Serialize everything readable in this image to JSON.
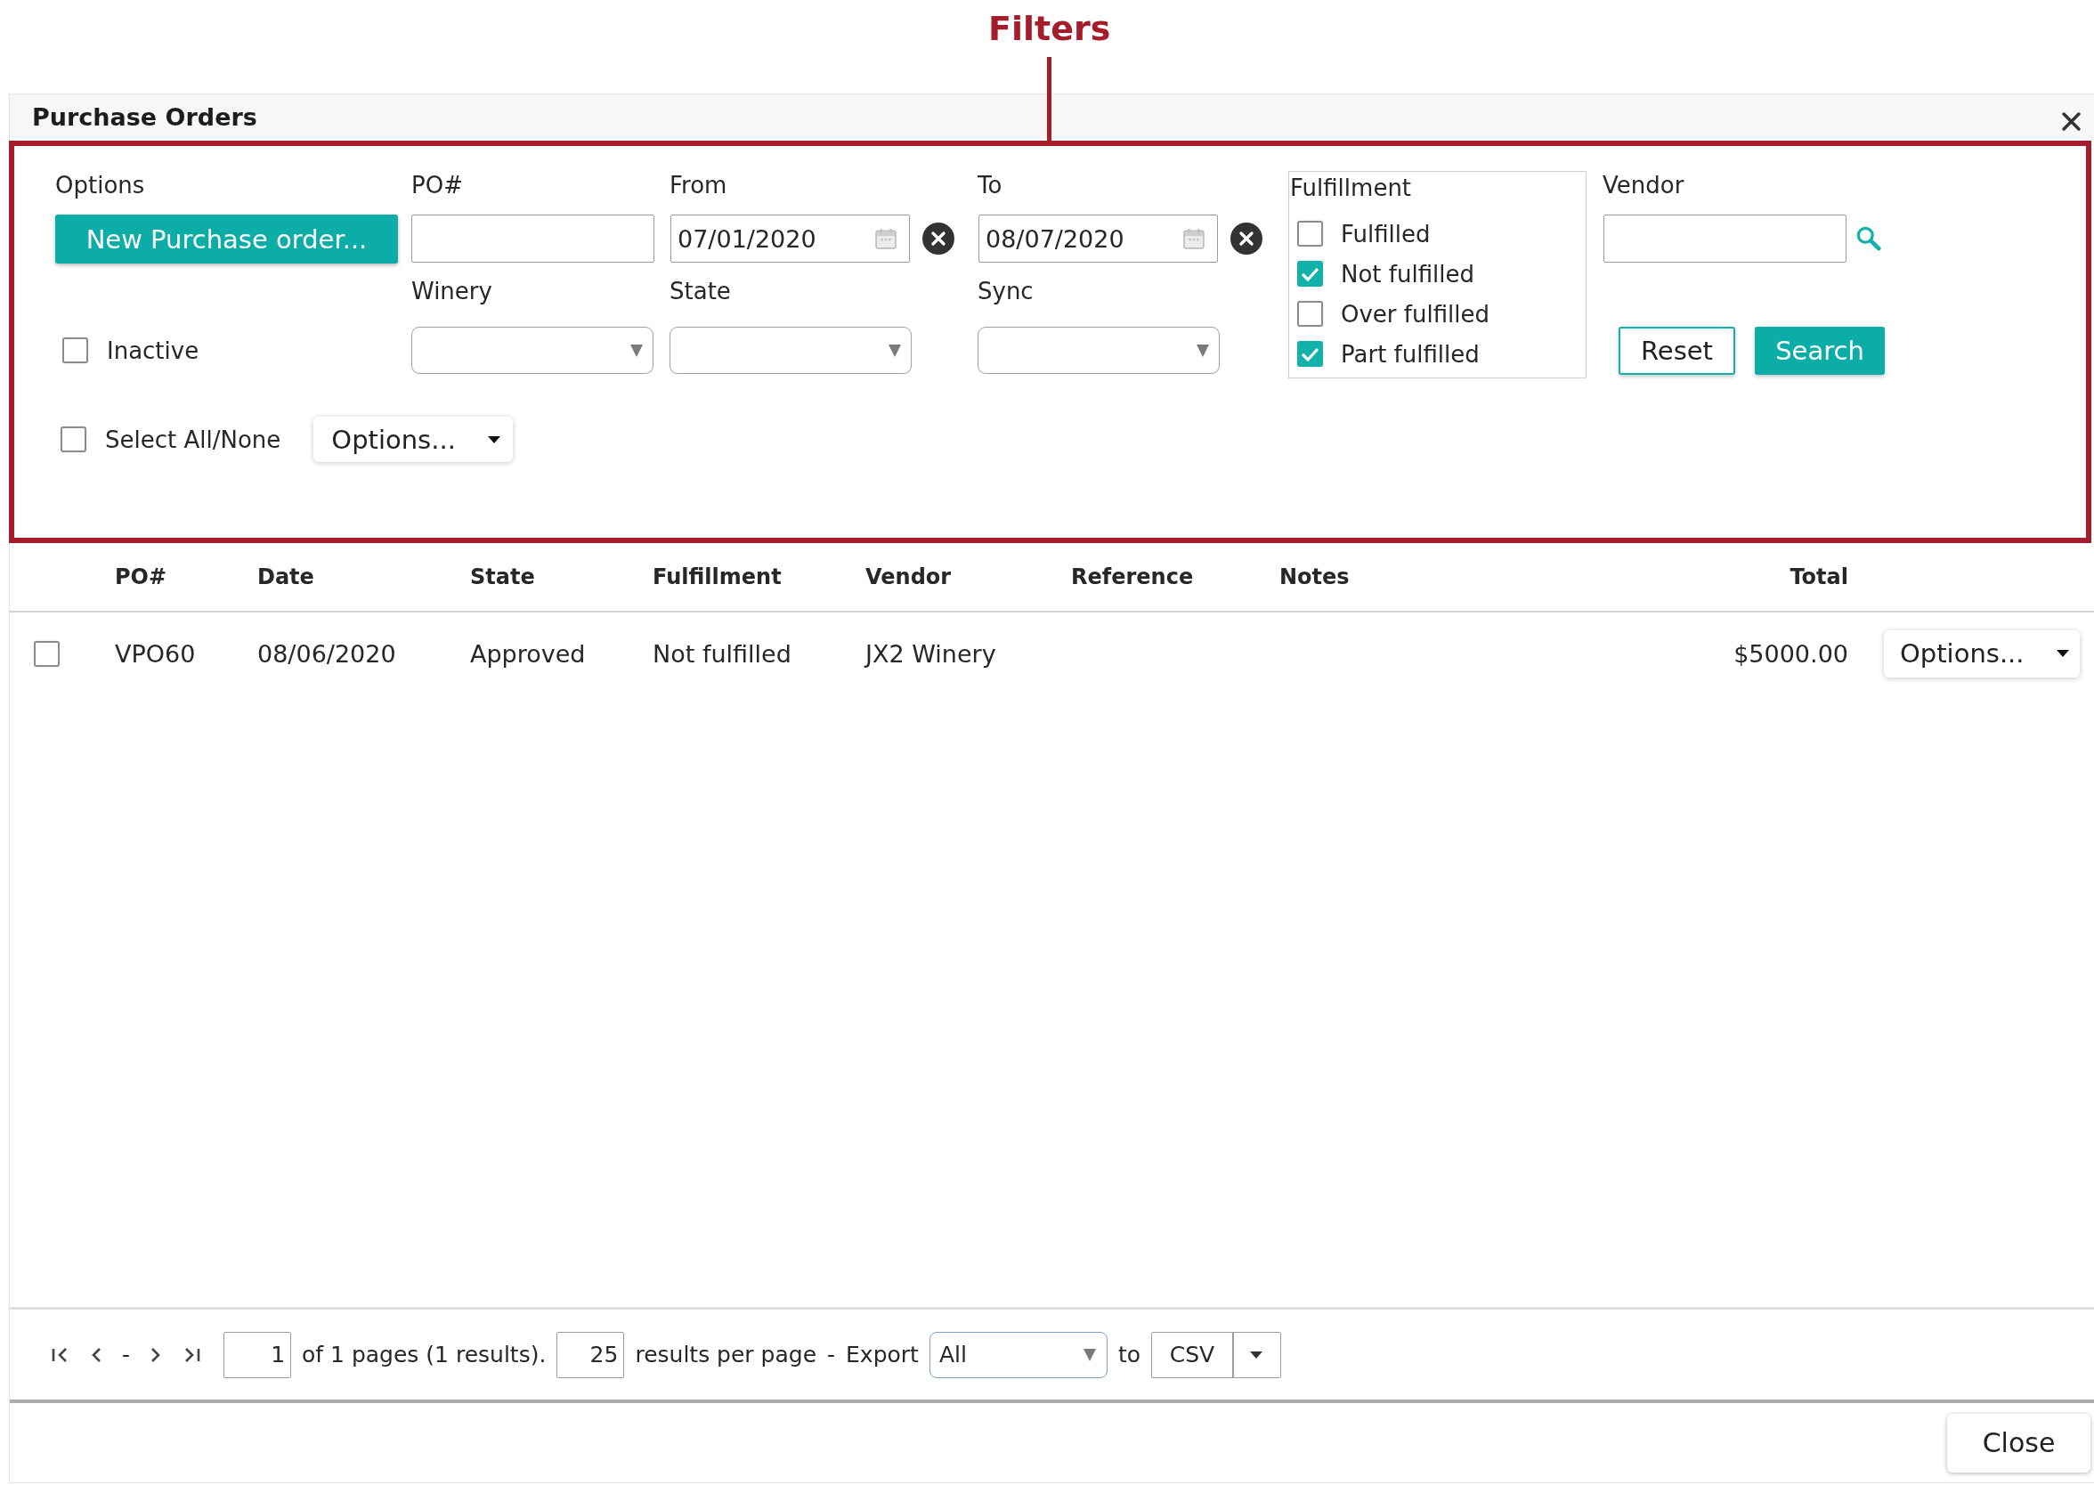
{
  "annotation": {
    "label": "Filters"
  },
  "window": {
    "title": "Purchase Orders"
  },
  "filters": {
    "options": {
      "label": "Options",
      "button": "New Purchase order..."
    },
    "po_number": {
      "label": "PO#"
    },
    "dates": [
      {
        "label": "From",
        "value": "07/01/2020"
      },
      {
        "label": "To",
        "value": "08/07/2020"
      }
    ],
    "selects": [
      {
        "label": "Winery"
      },
      {
        "label": "State"
      },
      {
        "label": "Sync"
      }
    ],
    "inactive": {
      "label": "Inactive",
      "checked": false
    },
    "fulfillment": {
      "label": "Fulfillment",
      "options": [
        {
          "label": "Fulfilled",
          "checked": false
        },
        {
          "label": "Not fulfilled",
          "checked": true
        },
        {
          "label": "Over fulfilled",
          "checked": false
        },
        {
          "label": "Part fulfilled",
          "checked": true
        }
      ]
    },
    "vendor": {
      "label": "Vendor"
    },
    "buttons": [
      {
        "label": "Reset",
        "kind": "secondary"
      },
      {
        "label": "Search",
        "kind": "primary"
      }
    ],
    "select_all": {
      "label": "Select All/None",
      "checked": false
    },
    "bulk_options": {
      "label": "Options..."
    }
  },
  "table": {
    "columns": [
      "PO#",
      "Date",
      "State",
      "Fulfillment",
      "Vendor",
      "Reference",
      "Notes",
      "Total"
    ],
    "rows": [
      {
        "selected": false,
        "po_number": "VPO60",
        "date": "08/06/2020",
        "state": "Approved",
        "fulfillment": "Not fulfilled",
        "vendor": "JX2 Winery",
        "total": "$5000.00",
        "options": "Options..."
      }
    ]
  },
  "pagination": {
    "nav_separator": "-",
    "page": "1",
    "summary": "of 1 pages (1 results).",
    "per_page": "25",
    "per_page_label": "results per page",
    "dash": "-",
    "export_label": "Export",
    "export_scope": "All",
    "to_label": "to",
    "format": "CSV"
  },
  "footer": {
    "buttons": [
      "Close"
    ]
  }
}
